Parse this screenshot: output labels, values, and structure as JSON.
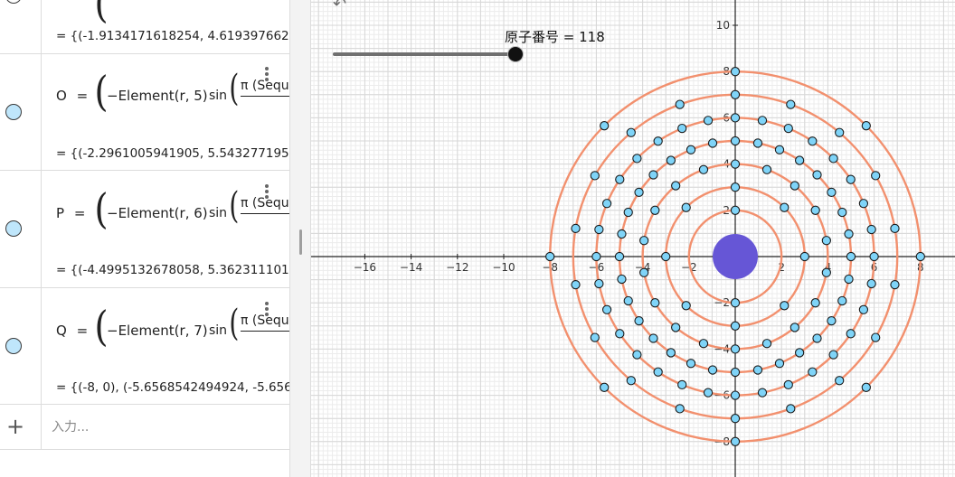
{
  "algebra": {
    "rows": [
      {
        "result": "= {(-1.9134171618254, 4.6193976625"
      },
      {
        "name": "O",
        "eq": "=",
        "prefix": "−Element(r, 5)",
        "fn": "sin",
        "frac_top": "π (Sequ",
        "result": "= {(-2.2961005941905, 5.5432771950"
      },
      {
        "name": "P",
        "eq": "=",
        "prefix": "−Element(r, 6)",
        "fn": "sin",
        "frac_top": "π (Sequ",
        "result": "= {(-4.4995132678058, 5.3623111018"
      },
      {
        "name": "Q",
        "eq": "=",
        "prefix": "−Element(r, 7)",
        "fn": "sin",
        "frac_top": "π (Sequ",
        "result": "= {(-8, 0), (-5.6568542494924, -5.656"
      }
    ],
    "input_placeholder": "入力..."
  },
  "slider": {
    "name": "原子番号",
    "value": 118,
    "label": "原子番号 = 118",
    "min": 1,
    "max": 118
  },
  "graph": {
    "x_ticks": [
      "−16",
      "−14",
      "−12",
      "−10",
      "−8",
      "−6",
      "−4",
      "−2",
      "2",
      "4",
      "6",
      "8"
    ],
    "y_ticks_pos": [
      "10",
      "8",
      "6",
      "4",
      "2"
    ],
    "y_ticks_neg": [
      "−2",
      "−4",
      "−6",
      "−8"
    ],
    "shells": [
      {
        "radius": 2,
        "electrons": 2
      },
      {
        "radius": 3,
        "electrons": 8
      },
      {
        "radius": 4,
        "electrons": 18
      },
      {
        "radius": 5,
        "electrons": 32
      },
      {
        "radius": 6,
        "electrons": 32
      },
      {
        "radius": 7,
        "electrons": 18
      },
      {
        "radius": 8,
        "electrons": 8
      }
    ],
    "colors": {
      "orbit": "#f2906e",
      "electron_fill": "#7fd4f8",
      "electron_stroke": "#1a1a1a",
      "nucleus": "#6656d6",
      "grid_minor": "#ececec",
      "grid_major": "#d7d7d7",
      "axis": "#222222"
    }
  },
  "icons": {
    "undo": "undo-icon",
    "add": "plus-icon",
    "menu": "kebab-menu-icon"
  }
}
